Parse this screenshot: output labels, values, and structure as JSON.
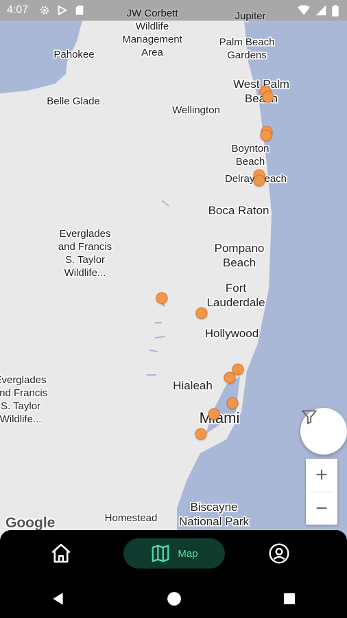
{
  "status_bar": {
    "time": "4:07"
  },
  "map": {
    "places": [
      {
        "name": "JW Corbett\nWildlife\nManagement\nArea",
        "size": "normal"
      },
      {
        "name": "Jupiter",
        "size": "normal"
      },
      {
        "name": "Pahokee",
        "size": "normal"
      },
      {
        "name": "Palm Beach\nGardens",
        "size": "normal"
      },
      {
        "name": "West Palm\nBeach",
        "size": "big"
      },
      {
        "name": "Belle Glade",
        "size": "normal"
      },
      {
        "name": "Wellington",
        "size": "normal"
      },
      {
        "name": "Boynton\nBeach",
        "size": "normal"
      },
      {
        "name": "Delray Beach",
        "size": "normal"
      },
      {
        "name": "Boca Raton",
        "size": "big"
      },
      {
        "name": "Everglades\nand Francis\nS. Taylor\nWildlife...",
        "size": "normal"
      },
      {
        "name": "Pompano\nBeach",
        "size": "big"
      },
      {
        "name": "Fort\nLauderdale",
        "size": "big"
      },
      {
        "name": "Hollywood",
        "size": "big"
      },
      {
        "name": "Everglades\nand Francis\nS. Taylor\nWildlife...",
        "size": "normal"
      },
      {
        "name": "Hialeah",
        "size": "big"
      },
      {
        "name": "Miami",
        "size": "huge"
      },
      {
        "name": "Homestead",
        "size": "normal"
      },
      {
        "name": "Biscayne\nNational Park",
        "size": "big"
      }
    ],
    "pin_count": 13,
    "pin_color": "#f2964a",
    "water_color": "#aab8d8",
    "land_color": "#e9e9e9",
    "attribution": "Google"
  },
  "controls": {
    "filter_icon": "filter-funnel-icon",
    "zoom_in": "+",
    "zoom_out": "−"
  },
  "bottom_nav": {
    "home_icon": "home-icon",
    "map_label": "Map",
    "map_icon": "map-icon",
    "profile_icon": "account-circle-icon",
    "active_color": "#4ddfa6"
  }
}
